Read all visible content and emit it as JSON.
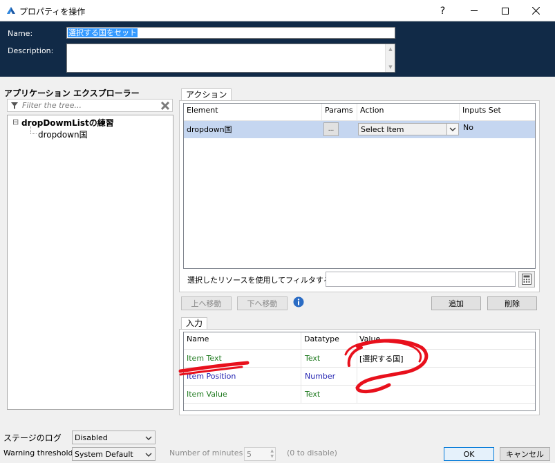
{
  "window": {
    "title": "プロパティを操作",
    "help_label": "?",
    "minimize_label": "—",
    "maximize_label": "☐",
    "close_label": "✕"
  },
  "header": {
    "name_label": "Name:",
    "name_value": "選択する国をセット",
    "description_label": "Description:",
    "description_value": ""
  },
  "explorer": {
    "title": "アプリケーション エクスプローラー",
    "filter_placeholder": "Filter the tree...",
    "tree": {
      "root_label": "dropDowmListの練習",
      "expander": "⊟",
      "child_label": "dropdown国"
    }
  },
  "actions": {
    "tab_label": "アクション",
    "columns": [
      "Element",
      "Params",
      "Action",
      "Inputs Set"
    ],
    "row": {
      "element": "dropdown国",
      "params_button": "...",
      "action_selected": "Select Item",
      "inputs_set": "No"
    },
    "filter_label": "選択したリソースを使用してフィルタする",
    "move_up": "上へ移動",
    "move_down": "下へ移動",
    "add": "追加",
    "delete": "削除"
  },
  "inputs": {
    "tab_label": "入力",
    "columns": [
      "Name",
      "Datatype",
      "Value"
    ],
    "rows": [
      {
        "name": "Item Text",
        "datatype": "Text",
        "value": "[選択する国]"
      },
      {
        "name": "Item Position",
        "datatype": "Number",
        "value": ""
      },
      {
        "name": "Item Value",
        "datatype": "Text",
        "value": ""
      }
    ]
  },
  "footer": {
    "stage_log_label": "ステージのログ",
    "stage_log_value": "Disabled",
    "warning_label": "Warning threshold:",
    "warning_value": "System Default",
    "minutes_label": "Number of minutes",
    "minutes_value": "5",
    "zero_hint": "(0 to disable)",
    "ok": "OK",
    "cancel": "キャンセル"
  },
  "colors": {
    "header_bg": "#112a47",
    "selection": "#3399ff",
    "row_selected": "#c5d6f0",
    "annotation": "#e8101c",
    "green_text": "#1f7a1f",
    "blue_text": "#1f1fb0"
  }
}
